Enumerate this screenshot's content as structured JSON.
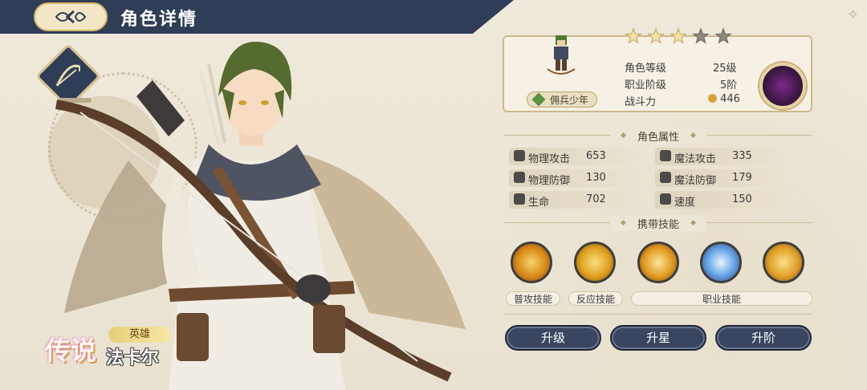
{
  "header": {
    "title": "角色详情"
  },
  "character": {
    "rarity": "传说",
    "title": "英雄",
    "name": "法卡尔"
  },
  "info": {
    "stars_total": 5,
    "stars_filled": 3,
    "job_tag": "佣兵少年",
    "level_label": "角色等级",
    "level_value": "25级",
    "rank_label": "职业阶级",
    "rank_value": "5阶",
    "power_label": "战斗力",
    "power_value": "446"
  },
  "attributes": {
    "section_title": "角色属性",
    "items": [
      {
        "label": "物理攻击",
        "value": "653",
        "icon": "sword-icon"
      },
      {
        "label": "魔法攻击",
        "value": "335",
        "icon": "magic-attack-icon"
      },
      {
        "label": "物理防御",
        "value": "130",
        "icon": "shield-icon"
      },
      {
        "label": "魔法防御",
        "value": "179",
        "icon": "magic-defense-icon"
      },
      {
        "label": "生命",
        "value": "702",
        "icon": "heart-icon"
      },
      {
        "label": "速度",
        "value": "150",
        "icon": "speed-icon"
      }
    ]
  },
  "skills": {
    "section_title": "携带技能",
    "labels": {
      "basic": "普攻技能",
      "reaction": "反应技能",
      "job": "职业技能"
    },
    "icons": [
      "arrow-shot-icon",
      "counter-arrow-icon",
      "cross-strike-icon",
      "ice-rain-icon",
      "crescent-slash-icon"
    ]
  },
  "actions": {
    "upgrade": "升级",
    "star_up": "升星",
    "rank_up": "升阶"
  },
  "colors": {
    "header": "#2f3d57",
    "button": "#3a4660",
    "gold": "#d8b870",
    "accent_green": "#5c8f3e"
  }
}
